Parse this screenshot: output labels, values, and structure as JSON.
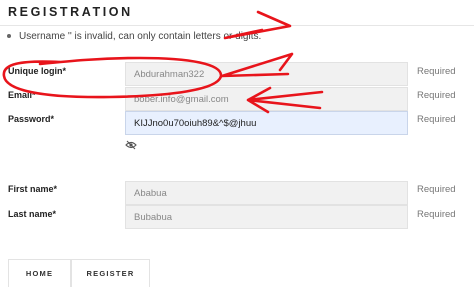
{
  "page": {
    "title": "REGISTRATION"
  },
  "errors": [
    "Username '' is invalid, can only contain letters or digits."
  ],
  "fields": {
    "login": {
      "label": "Unique login*",
      "value": "Abdurahman322",
      "required": "Required"
    },
    "email": {
      "label": "Email*",
      "value": "bober.info@gmail.com",
      "required": "Required"
    },
    "password": {
      "label": "Password*",
      "value": "KIJJno0u70oiuh89&^$@jhuu",
      "required": "Required",
      "toggle_icon": "eye-slash-icon"
    },
    "first_name": {
      "label": "First name*",
      "value": "Ababua",
      "required": "Required"
    },
    "last_name": {
      "label": "Last name*",
      "value": "Bubabua",
      "required": "Required"
    }
  },
  "buttons": {
    "home": "HOME",
    "register": "REGISTER"
  },
  "annotation": {
    "color": "#e8141b"
  }
}
